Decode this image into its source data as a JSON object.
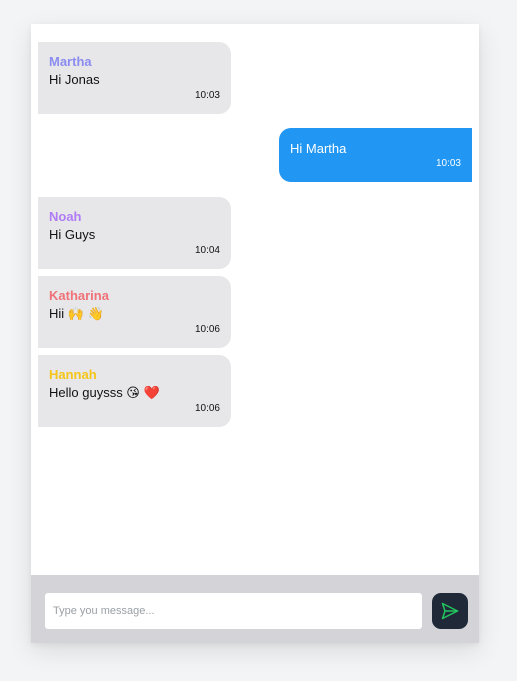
{
  "messages": [
    {
      "sender": "Martha",
      "text": "Hi Jonas",
      "time": "10:03",
      "direction": "in",
      "sender_color": "#8b8cf0"
    },
    {
      "text": "Hi Martha",
      "time": "10:03",
      "direction": "out"
    },
    {
      "sender": "Noah",
      "text": "Hi Guys",
      "time": "10:04",
      "direction": "in",
      "sender_color": "#b07cf5"
    },
    {
      "sender": "Katharina",
      "text": "Hii 🙌 👋",
      "time": "10:06",
      "direction": "in",
      "sender_color": "#f07178"
    },
    {
      "sender": "Hannah",
      "text": "Hello guysss 😘 ❤️",
      "time": "10:06",
      "direction": "in",
      "sender_color": "#f5c518"
    }
  ],
  "composer": {
    "placeholder": "Type you message...",
    "send_icon": "send-icon",
    "send_icon_color": "#22c55e"
  },
  "colors": {
    "outgoing_bubble": "#2196f3",
    "incoming_bubble": "#e7e7e9",
    "composer_bar": "#d4d4d8",
    "send_button": "#1f2937"
  }
}
